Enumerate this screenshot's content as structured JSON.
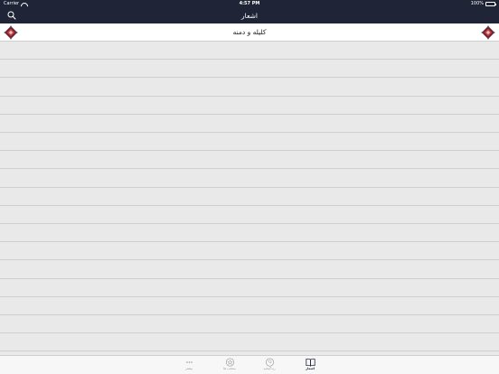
{
  "status_bar": {
    "carrier": "Carrier",
    "time": "4:57 PM",
    "battery": "100%"
  },
  "nav": {
    "title": "اشعار",
    "search_icon": "search-icon"
  },
  "list": {
    "first_item": "کلیله و دمنه",
    "ornament_icon": "ornament-icon"
  },
  "tabbar": {
    "tabs": [
      {
        "label": "اشعار",
        "icon": "book-icon",
        "active": true
      },
      {
        "label": "زندگینامه",
        "icon": "profile-icon",
        "active": false
      },
      {
        "label": "منتخب ها",
        "icon": "star-icon",
        "active": false
      },
      {
        "label": "بیشتر",
        "icon": "more-icon",
        "active": false
      }
    ]
  },
  "colors": {
    "nav_bg": "#1f2436",
    "content_bg": "#e8e8e8",
    "battery_green": "#4cd964"
  }
}
